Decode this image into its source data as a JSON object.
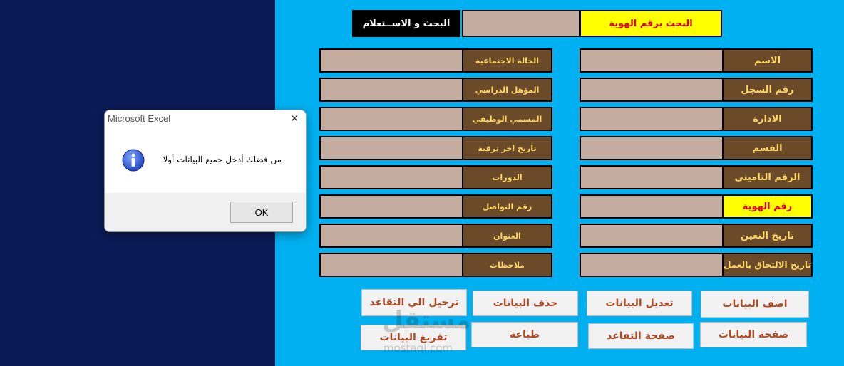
{
  "search": {
    "title": "البحث و الاســتعلام",
    "id_label": "البحث برقم الهوية",
    "id_value": ""
  },
  "right_fields": [
    {
      "label": "الاسم",
      "value": ""
    },
    {
      "label": "رقم السجل",
      "value": ""
    },
    {
      "label": "الادارة",
      "value": ""
    },
    {
      "label": "القسم",
      "value": ""
    },
    {
      "label": "الرقم التاميني",
      "value": ""
    },
    {
      "label": "رقم الهوية",
      "value": ""
    },
    {
      "label": "تاريخ التعين",
      "value": ""
    },
    {
      "label": "تاريخ الالتحاق بالعمل",
      "value": ""
    }
  ],
  "left_fields": [
    {
      "label": "الحالة الاجتماعية",
      "value": ""
    },
    {
      "label": "المؤهل الدراسي",
      "value": ""
    },
    {
      "label": "المسمي الوظيفي",
      "value": ""
    },
    {
      "label": "تاريخ اخر ترقية",
      "value": ""
    },
    {
      "label": "الدورات",
      "value": ""
    },
    {
      "label": "رقم التواصل",
      "value": ""
    },
    {
      "label": "العنوان",
      "value": ""
    },
    {
      "label": "ملاحظات",
      "value": ""
    }
  ],
  "buttons": {
    "add": "اضف البيانات",
    "edit": "تعديل البيانات",
    "delete": "حذف البيانات",
    "retire": "ترحيل الي التقاعد",
    "data_page": "صفحة البيانات",
    "retire_page": "صفحة التقاعد",
    "print": "طباعة",
    "clear": "تفريغ البيانات"
  },
  "dialog": {
    "title": "Microsoft Excel",
    "message": "من فضلك أدخل جميع البيانات أولا",
    "ok": "OK",
    "icon": "info-icon"
  },
  "watermark": {
    "arabic": "مستقل",
    "latin": "mostaql.com"
  },
  "colors": {
    "background": "#00b0f0",
    "left_panel": "#0a1a56",
    "label_bg": "#6b4a2a",
    "label_text": "#ffd966",
    "input_bg": "#c4aca0",
    "highlight_bg": "#ffff00",
    "highlight_text": "#e00000",
    "button_text": "#b04a22"
  }
}
